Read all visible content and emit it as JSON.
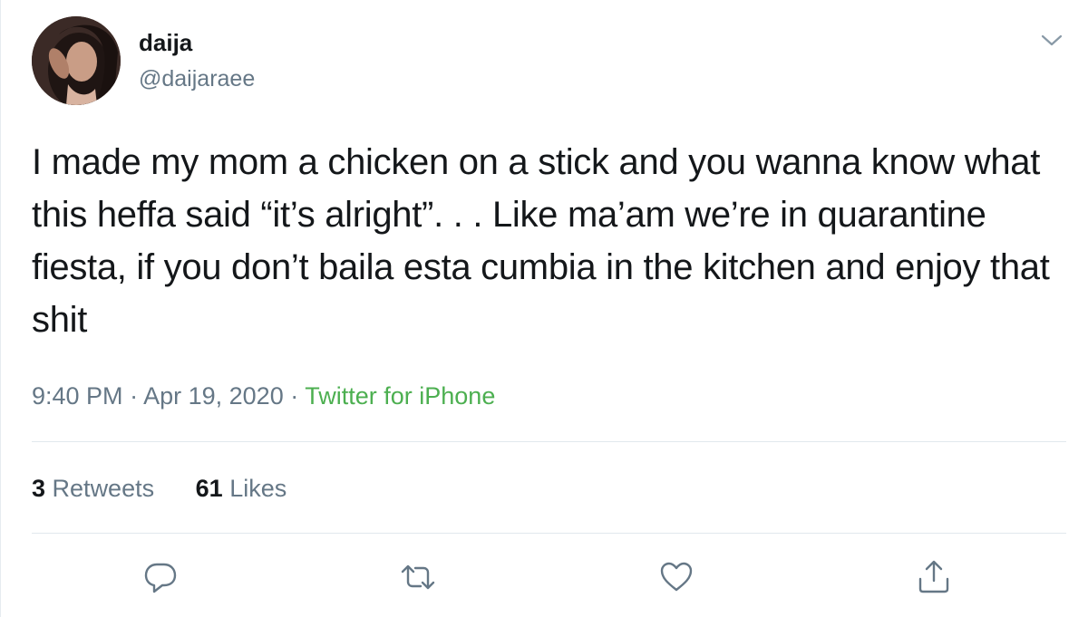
{
  "user": {
    "display_name": "daija",
    "handle": "@daijaraee",
    "avatar_icon": "profile-photo"
  },
  "tweet": {
    "text": "I made my mom a chicken on a stick and you wanna know what this heffa said “it’s alright”. . . Like ma’am we’re in quarantine fiesta, if you don’t baila esta cumbia in the kitchen and enjoy that shit",
    "time": "9:40 PM",
    "separator": "·",
    "date": "Apr 19, 2020",
    "source": "Twitter for iPhone"
  },
  "stats": {
    "retweets_count": "3",
    "retweets_label": "Retweets",
    "likes_count": "61",
    "likes_label": "Likes"
  },
  "actions": {
    "reply_icon": "reply-icon",
    "retweet_icon": "retweet-icon",
    "like_icon": "heart-icon",
    "share_icon": "share-icon",
    "menu_icon": "chevron-down-icon"
  },
  "colors": {
    "text": "#14171a",
    "secondary": "#657786",
    "source_link": "#4caf50",
    "divider": "#e1e8ed",
    "icon": "#657786"
  }
}
